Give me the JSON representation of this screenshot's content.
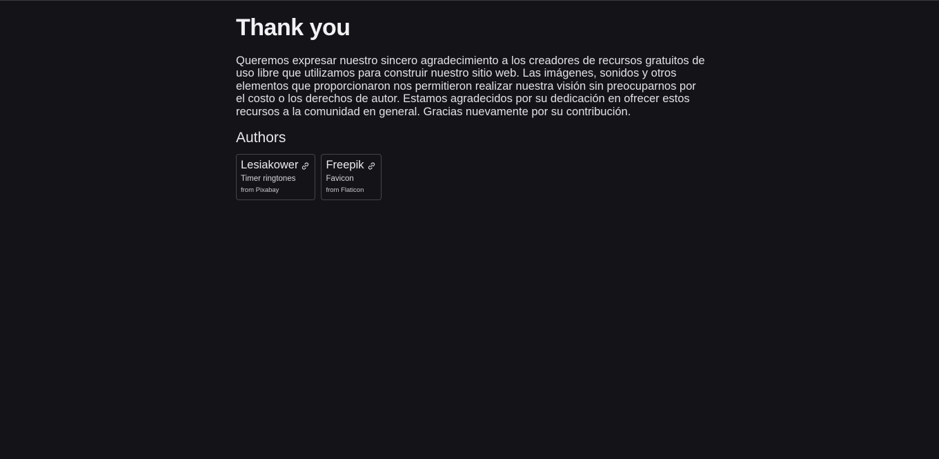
{
  "page": {
    "title": "Thank you",
    "intro": "Queremos expresar nuestro sincero agradecimiento a los creadores de recursos gratuitos de uso libre que utilizamos para construir nuestro sitio web. Las imágenes, sonidos y otros elementos que proporcionaron nos permitieron realizar nuestra visión sin preocuparnos por el costo o los derechos de autor. Estamos agradecidos por su dedicación en ofrecer estos recursos a la comunidad en general. Gracias nuevamente por su contribución.",
    "authors_heading": "Authors"
  },
  "authors": [
    {
      "name": "Lesiakower",
      "icon": "link-icon",
      "resource": "Timer ringtones",
      "source": "from Pixabay"
    },
    {
      "name": "Freepik",
      "icon": "link-icon",
      "resource": "Favicon",
      "source": "from Flaticon"
    }
  ],
  "colors": {
    "background": "#141418",
    "text": "#e6e6ea",
    "card_border": "#44444c"
  }
}
